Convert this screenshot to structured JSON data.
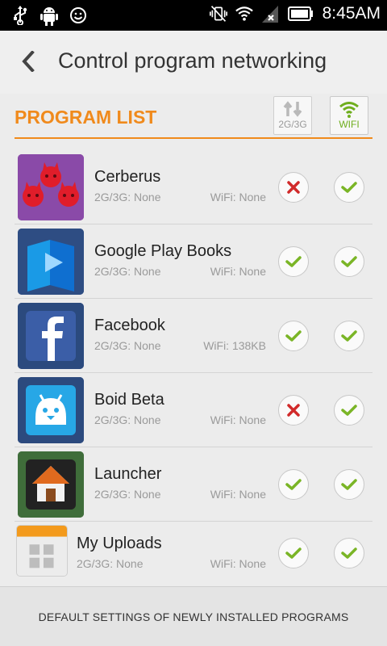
{
  "statusbar": {
    "time": "8:45AM",
    "icons": [
      "usb-icon",
      "android-debug-icon",
      "smiley-icon",
      "vibrate-icon",
      "wifi-icon",
      "no-signal-icon",
      "battery-icon"
    ]
  },
  "header": {
    "title": "Control program networking"
  },
  "program_list": {
    "title": "PROGRAM LIST",
    "mobile_button_label": "2G/3G",
    "wifi_button_label": "WIFI"
  },
  "apps": [
    {
      "name": "Cerberus",
      "mobile": "2G/3G: None",
      "wifi": "WiFi: None",
      "mobile_allowed": false,
      "wifi_allowed": true,
      "icon": "cerberus-icon"
    },
    {
      "name": "Google Play Books",
      "mobile": "2G/3G: None",
      "wifi": "WiFi: None",
      "mobile_allowed": true,
      "wifi_allowed": true,
      "icon": "play-books-icon"
    },
    {
      "name": "Facebook",
      "mobile": "2G/3G: None",
      "wifi": "WiFi: 138KB",
      "mobile_allowed": true,
      "wifi_allowed": true,
      "icon": "facebook-icon"
    },
    {
      "name": "Boid Beta",
      "mobile": "2G/3G: None",
      "wifi": "WiFi: None",
      "mobile_allowed": false,
      "wifi_allowed": true,
      "icon": "boid-icon"
    },
    {
      "name": "Launcher",
      "mobile": "2G/3G: None",
      "wifi": "WiFi: None",
      "mobile_allowed": true,
      "wifi_allowed": true,
      "icon": "launcher-icon"
    },
    {
      "name": "My Uploads",
      "mobile": "2G/3G: None",
      "wifi": "WiFi: None",
      "mobile_allowed": true,
      "wifi_allowed": true,
      "icon": "my-uploads-icon"
    }
  ],
  "footer": {
    "label": "DEFAULT SETTINGS OF NEWLY INSTALLED PROGRAMS"
  },
  "colors": {
    "accent": "#f08a1c",
    "allowed": "#7ab526",
    "blocked": "#d12a2a",
    "statusbar": "#000000"
  }
}
